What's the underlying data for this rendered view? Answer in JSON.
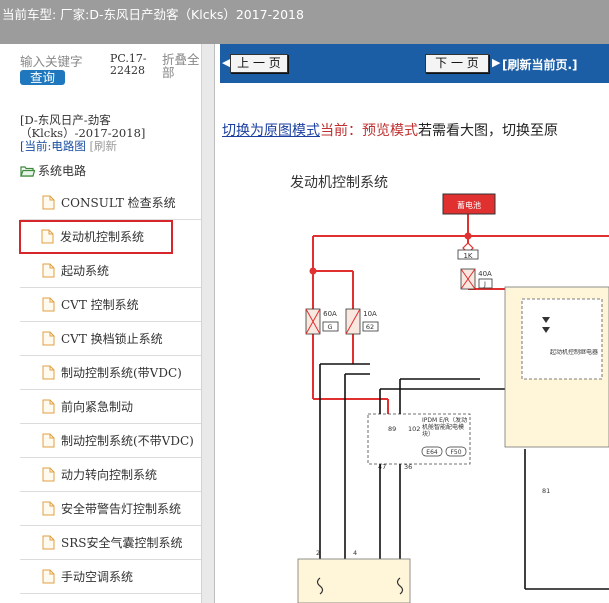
{
  "titlebar": {
    "text": "当前车型:   厂家:D-东风日产劲客（Klcks）2017-2018"
  },
  "left": {
    "search_label": "输入关键字",
    "search_button": "查询",
    "pc_code": "PC.17-22428",
    "collapse": "折叠全部",
    "vehicle_name": "[D-东风日产-劲客（Klcks）-2017-2018]",
    "current_label": "[当前:",
    "current_value": "电路图",
    "refresh": "[刷新",
    "folder": "系统电路",
    "items": [
      {
        "label": "CONSULT 检查系统"
      },
      {
        "label": "发动机控制系统"
      },
      {
        "label": "起动系统"
      },
      {
        "label": "CVT 控制系统"
      },
      {
        "label": "CVT 换档锁止系统"
      },
      {
        "label": "制动控制系统(带VDC)"
      },
      {
        "label": "前向紧急制动"
      },
      {
        "label": "制动控制系统(不带VDC)"
      },
      {
        "label": "动力转向控制系统"
      },
      {
        "label": "安全带警告灯控制系统"
      },
      {
        "label": "SRS安全气囊控制系统"
      },
      {
        "label": "手动空调系统"
      }
    ]
  },
  "toolbar": {
    "prev": "上 一 页",
    "next": "下 一 页",
    "refresh": "[刷新当前页.]"
  },
  "modebar": {
    "link": "切换为原图模式",
    "current": "当前：预览模式",
    "hint": "若需看大图，切换至原"
  },
  "diagram": {
    "title": "发动机控制系统",
    "battery_label": "蓄电池",
    "fuse_1k": "1K",
    "fuse_40a": "40A",
    "fuse_40a_id": "J",
    "fuse_60a": "60A",
    "fuse_60a_id": "G",
    "fuse_10a": "10A",
    "fuse_10a_id": "62",
    "ipdm_label": "IPDM E/R（发动机舱智能配电模块）",
    "conn_e64": "E64",
    "conn_f50": "F50",
    "pin_89": "89",
    "pin_102": "102",
    "pin_47": "47",
    "pin_36": "36",
    "pin_2": "2",
    "pin_4": "4",
    "pin_81": "81",
    "relay_label": "起动机控制继电器"
  },
  "colors": {
    "toolbar": "#1b5ea5",
    "wire_red": "#e03030",
    "selection": "#d6262b"
  }
}
